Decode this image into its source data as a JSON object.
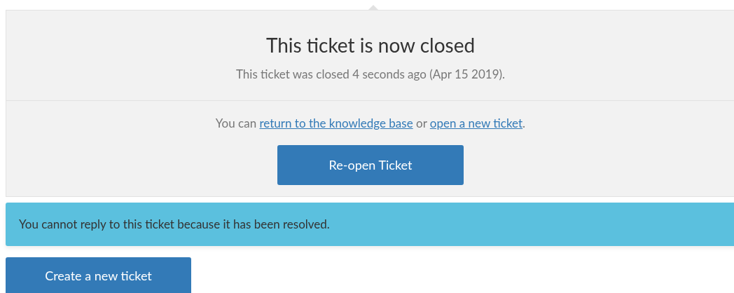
{
  "closed_panel": {
    "title": "This ticket is now closed",
    "subtitle": "This ticket was closed 4 seconds ago (Apr 15 2019).",
    "options": {
      "prefix": "You can ",
      "link_1": "return to the knowledge base",
      "middle": " or ",
      "link_2": "open a new ticket",
      "suffix": "."
    },
    "button": "Re-open Ticket"
  },
  "alert": {
    "text": "You cannot reply to this ticket because it has been resolved."
  },
  "create_button": "Create a new ticket"
}
